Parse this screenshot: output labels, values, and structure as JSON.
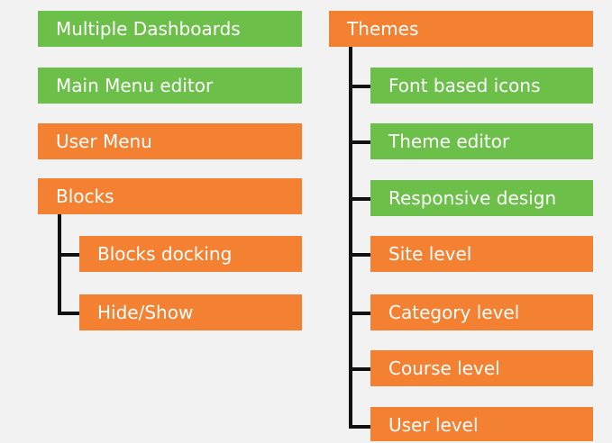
{
  "colors": {
    "green": "#6cc04a",
    "orange": "#f48132",
    "connector": "#111111",
    "background": "#f2f2f2",
    "text": "#ffffff"
  },
  "left_column": {
    "multiple_dashboards": "Multiple Dashboards",
    "main_menu_editor": "Main Menu editor",
    "user_menu": "User Menu",
    "blocks": "Blocks",
    "blocks_children": {
      "blocks_docking": "Blocks docking",
      "hide_show": "Hide/Show"
    }
  },
  "right_column": {
    "themes": "Themes",
    "themes_children": {
      "font_based_icons": "Font based icons",
      "theme_editor": "Theme editor",
      "responsive_design": "Responsive design",
      "site_level": "Site level",
      "category_level": "Category level",
      "course_level": "Course level",
      "user_level": "User level"
    }
  }
}
